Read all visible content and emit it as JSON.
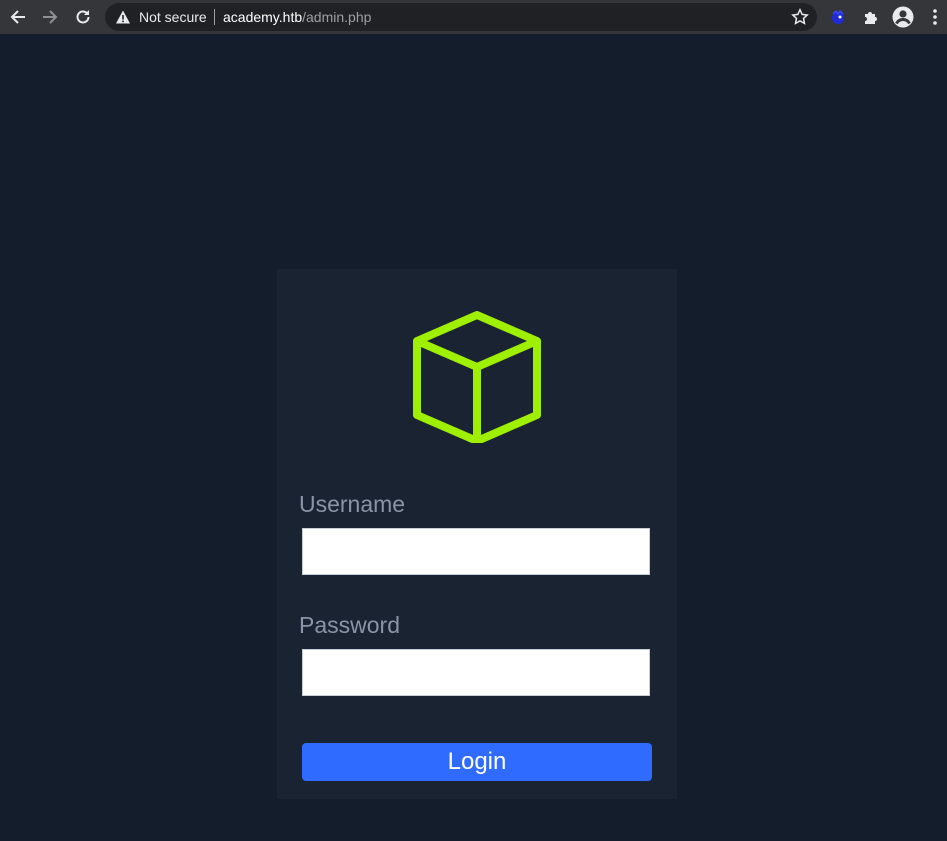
{
  "browser": {
    "security_text": "Not secure",
    "url_host": "academy.htb",
    "url_path": "/admin.php"
  },
  "icons": {
    "back": "back-arrow-icon",
    "forward": "forward-arrow-icon",
    "reload": "reload-icon",
    "warning": "warning-icon",
    "bookmark": "star-icon",
    "extension": "extension-icon",
    "puzzle": "puzzle-icon",
    "profile": "profile-icon",
    "menu": "kebab-menu-icon",
    "logo": "cube-icon"
  },
  "colors": {
    "page_bg": "#141d2b",
    "card_bg": "#1a2332",
    "accent": "#9fef00",
    "button": "#2f6bff"
  },
  "form": {
    "username_label": "Username",
    "username_value": "",
    "password_label": "Password",
    "password_value": "",
    "login_label": "Login"
  }
}
